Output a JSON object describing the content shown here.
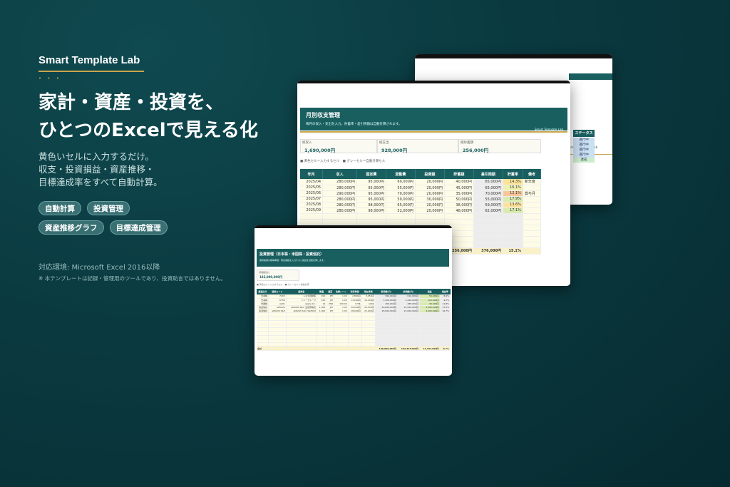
{
  "hero": {
    "brand": "Smart Template Lab",
    "dots": "• • •",
    "headline_1": "家計・資産・投資を、",
    "headline_2": "ひとつのExcelで見える化",
    "sub_1": "黄色いセルに入力するだけ。",
    "sub_2": "収支・投資損益・資産推移・",
    "sub_3": "目標達成率をすべて自動計算。",
    "tags": [
      "自動計算",
      "投資管理",
      "資産推移グラフ",
      "目標達成管理"
    ],
    "env": "対応環境: Microsoft Excel 2016以降",
    "note": "※ 本テンプレートは記録・管理用のツールであり、投資助言ではありません。"
  },
  "monthly_sheet": {
    "title": "月別収支管理",
    "desc": "毎月の収入・支出を入力。貯蓄率・差引残額は自動計算されます。",
    "logo": "Smart Template Lab",
    "kpis": [
      {
        "label": "総収入",
        "value": "1,690,000円"
      },
      {
        "label": "総支出",
        "value": "928,000円"
      },
      {
        "label": "総貯蓄額",
        "value": "256,000円"
      }
    ],
    "legend": "■ 黄色セル＝入力するセル　■ グレーセル＝自動計算セル",
    "headers": [
      "年月",
      "収入",
      "固定費",
      "変動費",
      "投資額",
      "貯蓄額",
      "差引残額",
      "貯蓄率",
      "備考"
    ],
    "rows": [
      [
        "2025/04",
        "280,000円",
        "95,000円",
        "60,000円",
        "20,000円",
        "40,000円",
        "65,000円",
        "14.3%",
        "新年度"
      ],
      [
        "2025/05",
        "280,000円",
        "95,000円",
        "55,000円",
        "20,000円",
        "45,000円",
        "65,000円",
        "16.1%",
        ""
      ],
      [
        "2025/06",
        "290,000円",
        "95,000円",
        "70,000円",
        "20,000円",
        "35,000円",
        "70,000円",
        "12.1%",
        "賞与月"
      ],
      [
        "2025/07",
        "280,000円",
        "95,000円",
        "50,000円",
        "30,000円",
        "50,000円",
        "55,000円",
        "17.9%",
        ""
      ],
      [
        "2025/08",
        "280,000円",
        "98,000円",
        "65,000円",
        "20,000円",
        "38,000円",
        "59,000円",
        "13.6%",
        ""
      ],
      [
        "2025/09",
        "280,000円",
        "98,000円",
        "52,000円",
        "20,000円",
        "48,000円",
        "62,000円",
        "17.1%",
        ""
      ]
    ],
    "total": [
      "合計",
      "1,690,000円",
      "576,000円",
      "352,000円",
      "130,000円",
      "256,000円",
      "376,000円",
      "15.1%",
      ""
    ]
  },
  "back_sheet": {
    "logo": "Smart Template Lab",
    "status_header": "ステータス",
    "statuses": [
      "進行中",
      "進行中",
      "進行中",
      "進行中",
      "達成"
    ]
  },
  "invest_sheet": {
    "title": "投資管理（日本株・米国株・投資信託）",
    "desc": "保有銘柄の取得単価・現在価格を入力すると損益を自動計算します。",
    "kpi_label": "評価額合計",
    "kpi_value": "182,000,000円",
    "legend": "■ 黄色セル＝入力するセル　■ グレーセル＝自動計算",
    "headers": [
      "資産区分",
      "銘柄コード",
      "銘柄名",
      "数量",
      "通貨",
      "為替レート",
      "取得単価",
      "現在単価",
      "取得額(円)",
      "評価額(円)",
      "損益",
      "損益率"
    ],
    "rows": [
      [
        "日本株",
        "7203",
        "トヨタ自動車",
        "200",
        "JPY",
        "1.00",
        "2,800円",
        "3,050円",
        "560,000円",
        "610,000円",
        "50,000円",
        "8.9%"
      ],
      [
        "日本株",
        "6758",
        "ソニーグループ",
        "100",
        "JPY",
        "1.00",
        "13,000円",
        "14,200円",
        "1,300,000円",
        "1,420,000円",
        "120,000円",
        "9.2%"
      ],
      [
        "米国株",
        "AAPL",
        "Apple Inc.",
        "10",
        "USD",
        "150.00",
        "170$",
        "190$",
        "255,000円",
        "285,000円",
        "30,000円",
        "11.8%"
      ],
      [
        "投資信託",
        "eMAXIS",
        "eMAXIS Slim 全世界株式",
        "1,000",
        "JPY",
        "1.00",
        "20,000円",
        "23,500円",
        "20,000,000円",
        "23,500,000円",
        "3,500,000円",
        "17.5%"
      ],
      [
        "投資信託",
        "eMAXIS S&P",
        "eMAXIS Slim S&P500",
        "1,000",
        "JPY",
        "1.00",
        "18,000円",
        "21,000円",
        "18,000,000円",
        "21,000,000円",
        "3,000,000円",
        "16.7%"
      ]
    ],
    "total_label": "合計",
    "total_acq": "180,000,000円",
    "total_val": "194,327,000円",
    "total_pl": "14,327,000円",
    "total_rate": "8.7%"
  }
}
